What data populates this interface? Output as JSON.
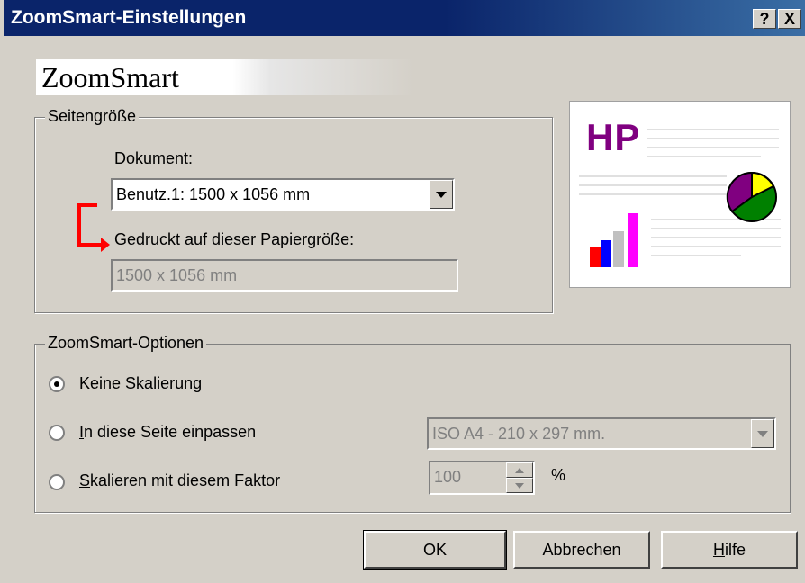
{
  "window": {
    "title": "ZoomSmart-Einstellungen",
    "help_btn": "?",
    "close_btn": "X"
  },
  "banner": {
    "brand": "ZoomSmart"
  },
  "page_size": {
    "legend": "Seitengröße",
    "document_label": "Dokument:",
    "document_value": "Benutz.1: 1500 x 1056 mm",
    "printed_label": "Gedruckt auf dieser Papiergröße:",
    "printed_value": "1500 x 1056 mm"
  },
  "preview": {
    "logo_text": "HP"
  },
  "options": {
    "legend": "ZoomSmart-Optionen",
    "no_scaling": {
      "underline": "K",
      "rest": "eine Skalierung",
      "selected": true
    },
    "fit_page": {
      "underline": "I",
      "rest": "n diese Seite einpassen",
      "selected": false,
      "paper_value": "ISO A4 - 210 x 297 mm."
    },
    "scale_factor": {
      "underline": "S",
      "rest": "kalieren mit diesem Faktor",
      "selected": false,
      "value": "100",
      "unit": "%"
    }
  },
  "buttons": {
    "ok": "OK",
    "cancel": "Abbrechen",
    "help_underline": "H",
    "help_rest": "ilfe"
  },
  "colors": {
    "title_bar": "#0a246a",
    "face": "#d4d0c8",
    "accent_arrow": "#ff0000",
    "hp_purple": "#800080"
  }
}
